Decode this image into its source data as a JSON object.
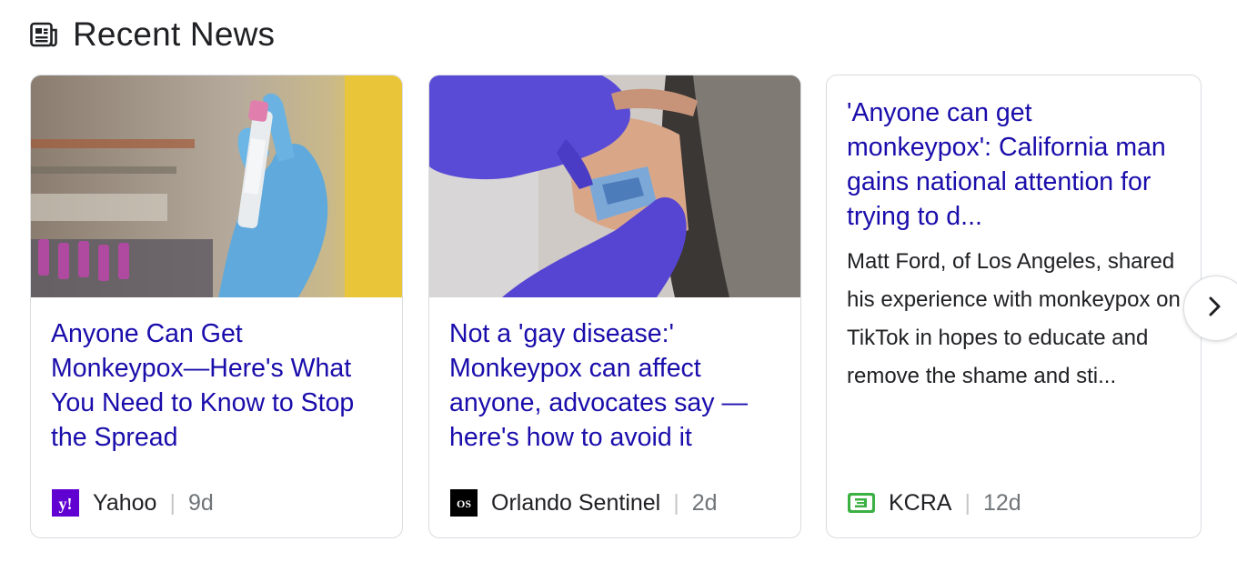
{
  "header": {
    "title": "Recent News",
    "icon": "newspaper-icon"
  },
  "cards": [
    {
      "headline": "Anyone Can Get Monkeypox—Here's What You Need to Know to Stop the Spread",
      "source": "Yahoo",
      "age": "9d",
      "source_logo": "y!",
      "source_color": "#6001d2",
      "image": "gloved-hand-holding-vial"
    },
    {
      "headline": "Not a 'gay disease:' Monkeypox can affect anyone, advocates say — here's how to avoid it",
      "source": "Orlando Sentinel",
      "age": "2d",
      "source_logo": "OS",
      "source_color": "#000000",
      "image": "vaccination-bandage"
    },
    {
      "headline": "'Anyone can get monkeypox': California man gains national attention for trying to d...",
      "snippet": "Matt Ford, of Los Angeles, shared his experience with monkeypox on TikTok in hopes to educate and remove the shame and sti...",
      "source": "KCRA",
      "age": "12d",
      "source_logo": "3",
      "source_color": "#3cb043"
    }
  ],
  "carousel": {
    "next_icon": "chevron-right-icon"
  },
  "colors": {
    "link": "#1a0dab",
    "text": "#202124",
    "muted": "#70757a",
    "border": "#dadce0"
  }
}
